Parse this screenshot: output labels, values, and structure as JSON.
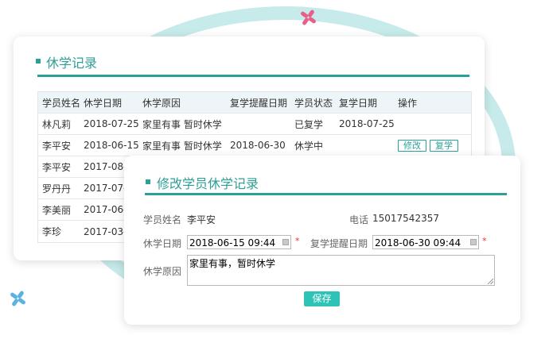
{
  "list_card": {
    "title": "休学记录",
    "columns": [
      "学员姓名",
      "休学日期",
      "休学原因",
      "复学提醒日期",
      "学员状态",
      "复学日期",
      "操作"
    ],
    "rows": [
      {
        "name": "林凡莉",
        "date": "2018-07-25",
        "reason": "家里有事 暂时休学",
        "remind": "",
        "status": "已复学",
        "return_date": "2018-07-25",
        "edit": "",
        "resume": ""
      },
      {
        "name": "李平安",
        "date": "2018-06-15",
        "reason": "家里有事 暂时休学",
        "remind": "2018-06-30",
        "status": "休学中",
        "return_date": "",
        "edit": "修改",
        "resume": "复学"
      },
      {
        "name": "李平安",
        "date": "2017-08-",
        "reason": "",
        "remind": "",
        "status": "",
        "return_date": "",
        "edit": "",
        "resume": ""
      },
      {
        "name": "罗丹丹",
        "date": "2017-07-",
        "reason": "",
        "remind": "",
        "status": "",
        "return_date": "",
        "edit": "",
        "resume": ""
      },
      {
        "name": "李美丽",
        "date": "2017-06-",
        "reason": "",
        "remind": "",
        "status": "",
        "return_date": "",
        "edit": "",
        "resume": ""
      },
      {
        "name": "李珍",
        "date": "2017-03-",
        "reason": "",
        "remind": "",
        "status": "",
        "return_date": "",
        "edit": "",
        "resume": ""
      }
    ]
  },
  "edit_card": {
    "title": "修改学员休学记录",
    "student_label": "学员姓名",
    "student_name": "李平安",
    "phone_label": "电话",
    "phone": "15017542357",
    "leave_date_label": "休学日期",
    "leave_date": "2018-06-15 09:44",
    "remind_label": "复学提醒日期",
    "remind_date": "2018-06-30 09:44",
    "required_mark": "*",
    "reason_label": "休学原因",
    "reason": "家里有事，暂时休学",
    "save_label": "保存"
  },
  "decor": {
    "ring_color": "#c7ebea",
    "accent": "#2aa198",
    "flower_pink": "#e8608a",
    "flower_yellow": "#f0c040",
    "flower_blue": "#5bb4e0"
  }
}
